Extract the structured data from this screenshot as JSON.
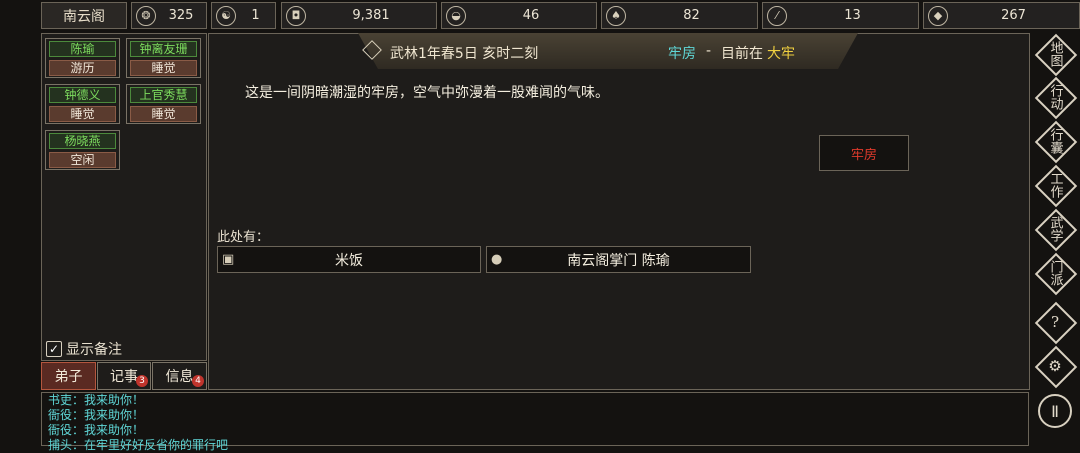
{
  "top_bar": {
    "sect_name": "南云阁",
    "resources": [
      {
        "icon": "reputation-icon",
        "value": "325"
      },
      {
        "icon": "yin-yang-icon",
        "value": "1"
      },
      {
        "icon": "coin-icon",
        "value": "9,381"
      },
      {
        "icon": "food-bowl-icon",
        "value": "46"
      },
      {
        "icon": "herb-icon",
        "value": "82"
      },
      {
        "icon": "wood-icon",
        "value": "13"
      },
      {
        "icon": "ore-icon",
        "value": "267"
      }
    ]
  },
  "disciples": [
    {
      "name": "陈瑜",
      "status": "游历"
    },
    {
      "name": "钟离友珊",
      "status": "睡觉"
    },
    {
      "name": "钟德义",
      "status": "睡觉"
    },
    {
      "name": "上官秀慧",
      "status": "睡觉"
    },
    {
      "name": "杨晓燕",
      "status": "空闲"
    }
  ],
  "show_notes_label": "显示备注",
  "tabs": [
    {
      "label": "弟子",
      "badge": ""
    },
    {
      "label": "记事",
      "badge": "3"
    },
    {
      "label": "信息",
      "badge": "4"
    }
  ],
  "header": {
    "date": "武林1年春5日 亥时二刻",
    "location": "牢房",
    "separator": "-",
    "currently_at": "目前在",
    "area": "大牢"
  },
  "description": "这是一间阴暗潮湿的牢房，空气中弥漫着一股难闻的气味。",
  "exit_button": "牢房",
  "here_label": "此处有：",
  "items": [
    {
      "icon": "item-box-icon",
      "label": "米饭"
    },
    {
      "icon": "person-icon",
      "label": "南云阁掌门 陈瑜"
    }
  ],
  "side_menu": [
    {
      "name": "map",
      "label": "地图"
    },
    {
      "name": "action",
      "label": "行动"
    },
    {
      "name": "bag",
      "label": "行囊"
    },
    {
      "name": "work",
      "label": "工作"
    },
    {
      "name": "martial",
      "label": "武学"
    },
    {
      "name": "sect",
      "label": "门派"
    }
  ],
  "side_icons": {
    "help": "?",
    "settings": "⚙",
    "pause": "Ⅱ"
  },
  "log_lines": [
    "书吏：我来助你！",
    "衙役：我来助你！",
    "衙役：我来助你！",
    "捕头：在牢里好好反省你的罪行吧"
  ],
  "colors": {
    "name_green": "#7ddc5e",
    "location_cyan": "#5fd6d6",
    "area_yellow": "#f0d040",
    "exit_red": "#e03a2c"
  }
}
